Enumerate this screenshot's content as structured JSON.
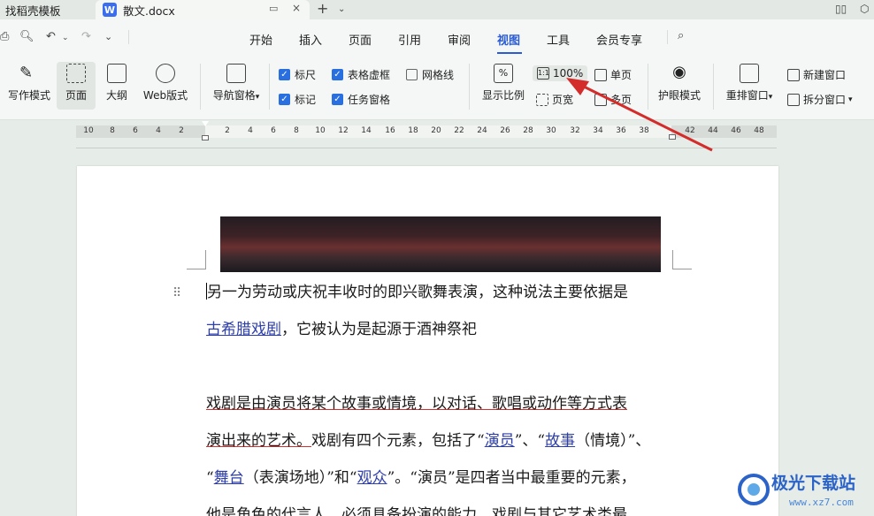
{
  "tabs": {
    "inactive_label": "找稻壳模板",
    "active_label": "散文.docx",
    "active_icon": "W",
    "new_tab_label": "+"
  },
  "menu": {
    "items": [
      "开始",
      "插入",
      "页面",
      "引用",
      "审阅",
      "视图",
      "工具",
      "会员专享"
    ],
    "active": "视图"
  },
  "ribbon": {
    "view_modes": [
      "写作模式",
      "页面",
      "大纲",
      "Web版式"
    ],
    "nav_pane": "导航窗格",
    "checks": [
      {
        "label": "标尺",
        "checked": true
      },
      {
        "label": "表格虚框",
        "checked": true
      },
      {
        "label": "网格线",
        "checked": false
      },
      {
        "label": "标记",
        "checked": true
      },
      {
        "label": "任务窗格",
        "checked": true
      }
    ],
    "zoom_group_label": "显示比例",
    "zoom_value": "100%",
    "page_width": "页宽",
    "single_page": "单页",
    "multi_page": "多页",
    "eye_mode": "护眼模式",
    "arrange_windows": "重排窗口",
    "new_window": "新建窗口",
    "split_window": "拆分窗口"
  },
  "ruler": {
    "ticks": [
      "10",
      "8",
      "6",
      "4",
      "2",
      "2",
      "4",
      "6",
      "8",
      "10",
      "12",
      "14",
      "16",
      "18",
      "20",
      "22",
      "24",
      "26",
      "28",
      "30",
      "32",
      "34",
      "36",
      "38",
      "42",
      "44",
      "46",
      "48"
    ]
  },
  "document": {
    "p1_a": "另一为劳动或庆祝丰收时的即兴歌舞表演，这种说法主要依据是",
    "p1_link": "古希腊戏剧",
    "p1_b": "，它被认为是起源于酒神祭祀",
    "p2_l1": "戏剧是由演员将某个故事或情境，以对话、歌唱或动作等方式表",
    "p2_l2a": "演出来的艺术。",
    "p2_l2b": "戏剧有四个元素，包括了“",
    "p2_link1": "演员",
    "p2_l2c": "”、“",
    "p2_link2": "故事",
    "p2_l2d": "（情境）”、",
    "p2_l3a": "“",
    "p2_link3": "舞台",
    "p2_l3b": "（表演场地）”和“",
    "p2_link4": "观众",
    "p2_l3c": "”。“演员”是四者当中最重要的元素，",
    "p2_l4": "他是角色的代言人，必须具备扮演的能力，戏剧与其它艺术类最"
  },
  "watermark": {
    "title": "极光下载站",
    "url": "www.xz7.com"
  },
  "colors": {
    "accent": "#2a5bd6",
    "arrow": "#d42b2b",
    "link": "#2f3fa8"
  }
}
